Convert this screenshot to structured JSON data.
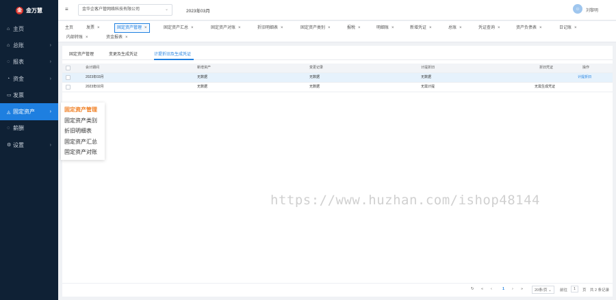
{
  "app": {
    "logo_text": "金万慧",
    "logo_mark": "金"
  },
  "sidebar": {
    "items": [
      {
        "icon": "home-icon",
        "glyph": "⌂",
        "label": "主页",
        "chevron": ""
      },
      {
        "icon": "ledger-icon",
        "glyph": "⌂",
        "label": "总账",
        "chevron": "›"
      },
      {
        "icon": "search-icon",
        "glyph": "◌",
        "label": "报表",
        "chevron": "›"
      },
      {
        "icon": "cash-icon",
        "glyph": "◔",
        "label": "资金",
        "chevron": "›"
      },
      {
        "icon": "invoice-icon",
        "glyph": "▭",
        "label": "发票",
        "chevron": ""
      },
      {
        "icon": "bell-icon",
        "glyph": "◬",
        "label": "固定资产",
        "chevron": "›"
      },
      {
        "icon": "salary-icon",
        "glyph": "◌",
        "label": "薪酬",
        "chevron": ""
      },
      {
        "icon": "gear-icon",
        "glyph": "⚙",
        "label": "设置",
        "chevron": "›"
      }
    ]
  },
  "header": {
    "menu_glyph": "≡",
    "company": "金华企客户管网络科技有限公司",
    "select_arrow": "⌄",
    "period": "2023年03月",
    "avatar_glyph": "☺",
    "username": "刘黎明"
  },
  "tabs": [
    {
      "label": "主页",
      "close": ""
    },
    {
      "label": "发票",
      "close": "×"
    },
    {
      "label": "固定资产管理",
      "close": "×"
    },
    {
      "label": "固定资产汇总",
      "close": "×"
    },
    {
      "label": "固定资产对账",
      "close": "×"
    },
    {
      "label": "折旧明细表",
      "close": "×"
    },
    {
      "label": "固定资产类别",
      "close": "×"
    },
    {
      "label": "报税",
      "close": "×"
    },
    {
      "label": "明细账",
      "close": "×"
    },
    {
      "label": "新增凭证",
      "close": "×"
    },
    {
      "label": "总账",
      "close": "×"
    },
    {
      "label": "凭证查询",
      "close": "×"
    },
    {
      "label": "资产负债表",
      "close": "×"
    },
    {
      "label": "日记账",
      "close": "×"
    },
    {
      "label": "内部转账",
      "close": "×"
    },
    {
      "label": "资金报表",
      "close": "×"
    }
  ],
  "subtabs": [
    "固定资产管理",
    "变更及生成凭证",
    "计提折旧及生成凭证"
  ],
  "table": {
    "headers": [
      "会计期间",
      "新增资产",
      "变更记录",
      "计提折旧",
      "折旧凭证",
      "操作"
    ],
    "rows": [
      {
        "period": "2023年03月",
        "new_asset": "无数据",
        "change": "无数据",
        "depreciation": "无数据",
        "voucher": "",
        "action": "计提折旧"
      },
      {
        "period": "2023年02月",
        "new_asset": "无数据",
        "change": "无数据",
        "depreciation": "无需计提",
        "voucher": "无需生成凭证",
        "action": ""
      }
    ]
  },
  "popup": {
    "items": [
      "固定资产管理",
      "固定资产类别",
      "折旧明细表",
      "固定资产汇总",
      "固定资产对账"
    ]
  },
  "watermark": "https://www.huzhan.com/ishop48144",
  "pager": {
    "refresh": "↻",
    "first": "«",
    "prev": "‹",
    "current": "1",
    "next": "›",
    "last": "»",
    "page_size": "20条/页 ⌄",
    "goto_label": "前往",
    "goto_value": "1",
    "page_unit": "页",
    "total": "共 2 条记录"
  },
  "colors": {
    "accent": "#1e7fe0",
    "sidebar_bg": "#0f2135",
    "popup_active": "#f07d20"
  }
}
